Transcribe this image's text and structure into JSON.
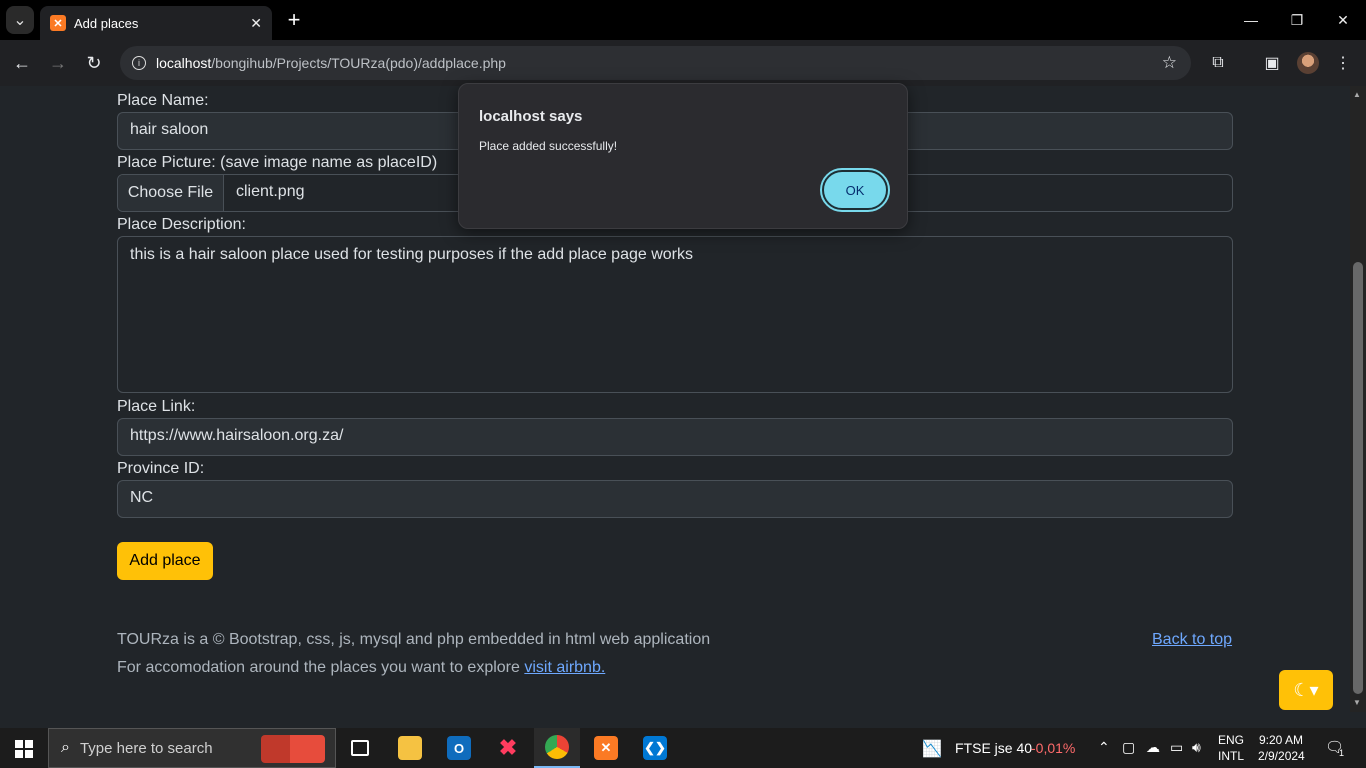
{
  "browser": {
    "tab_title": "Add places",
    "url_host": "localhost",
    "url_path": "/bongihub/Projects/TOURza(pdo)/addplace.php"
  },
  "form": {
    "place_name_label": "Place Name:",
    "place_name_value": "hair saloon",
    "place_picture_label": "Place Picture: (save image name as placeID)",
    "choose_file_label": "Choose File",
    "file_name": "client.png",
    "description_label": "Place Description:",
    "description_value": "this is a hair saloon place used for testing purposes if the add place page works",
    "link_label": "Place Link:",
    "link_value": "https://www.hairsaloon.org.za/",
    "province_label": "Province ID:",
    "province_value": "NC",
    "submit_label": "Add place"
  },
  "footer": {
    "line1": "TOURza is a © Bootstrap, css, js, mysql and php embedded in html web application",
    "line2_prefix": "For accomodation around the places you want to explore ",
    "line2_link": "visit airbnb.",
    "back_to_top": "Back to top"
  },
  "dialog": {
    "title": "localhost says",
    "message": "Place added successfully!",
    "ok_label": "OK"
  },
  "taskbar": {
    "search_placeholder": "Type here to search",
    "stock_name": "FTSE jse 40",
    "stock_change": "-0,01%",
    "lang1": "ENG",
    "lang2": "INTL",
    "time": "9:20 AM",
    "date": "2/9/2024",
    "notification_count": "1"
  },
  "colors": {
    "accent_yellow": "#ffc107",
    "link_blue": "#6ea8fe",
    "dialog_ok": "#78d9ec",
    "stock_negative": "#ff6b6b"
  }
}
